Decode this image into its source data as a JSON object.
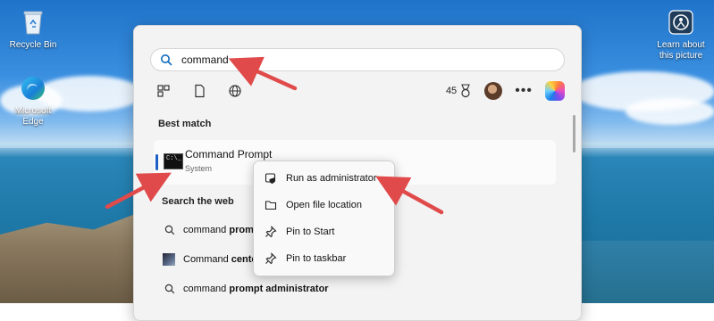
{
  "desktop": {
    "icons": [
      {
        "label": "Recycle Bin",
        "icon": "recycle-bin-icon"
      },
      {
        "label": "Microsoft Edge",
        "icon": "edge-icon"
      },
      {
        "label": "Learn about this picture",
        "icon": "camera-info-icon"
      }
    ]
  },
  "search": {
    "value": "command",
    "icon": "search-icon"
  },
  "filters": [
    {
      "icon": "apps-filter-icon"
    },
    {
      "icon": "documents-filter-icon"
    },
    {
      "icon": "web-filter-icon"
    }
  ],
  "rewards": {
    "points": "45",
    "icon": "rewards-medal-icon"
  },
  "more_label": "•••",
  "sections": {
    "best_match": "Best match",
    "search_web": "Search the web"
  },
  "best_match": {
    "title": "Command Prompt",
    "subtitle": "System",
    "icon_text": "C:\\_"
  },
  "web_results": [
    {
      "prefix": "command ",
      "bold": "promp",
      "icon": "search-icon"
    },
    {
      "prefix": "Command ",
      "bold": "cente",
      "icon": "thumbnail"
    },
    {
      "prefix": "command ",
      "bold": "prompt administrator",
      "icon": "search-icon"
    }
  ],
  "context_menu": {
    "items": [
      {
        "label": "Run as administrator",
        "icon": "shield-admin-icon"
      },
      {
        "label": "Open file location",
        "icon": "folder-icon"
      },
      {
        "label": "Pin to Start",
        "icon": "pin-icon"
      },
      {
        "label": "Pin to taskbar",
        "icon": "pin-icon"
      }
    ]
  },
  "colors": {
    "accent": "#1d5fc7",
    "annotation_arrow": "#e04a4a"
  }
}
